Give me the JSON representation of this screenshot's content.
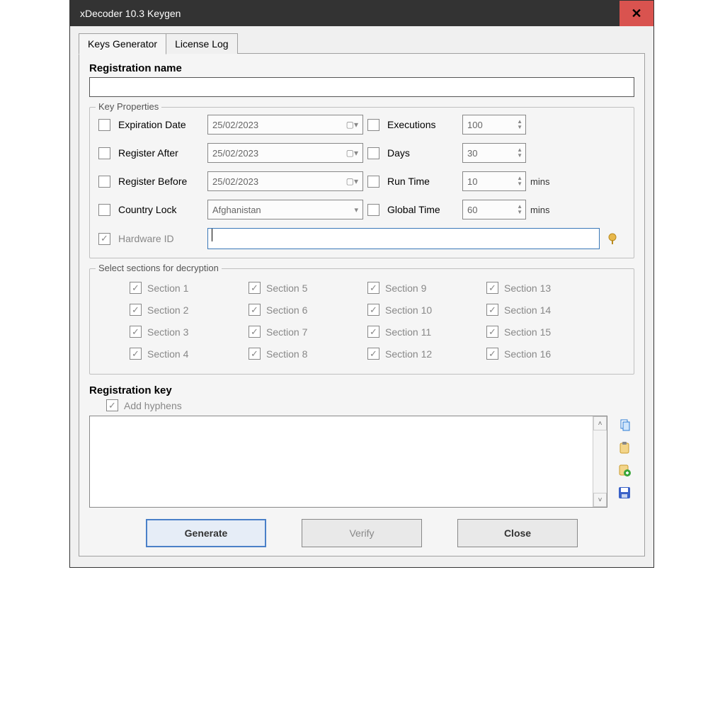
{
  "window": {
    "title": "xDecoder 10.3 Keygen"
  },
  "tabs": {
    "keys_generator": "Keys Generator",
    "license_log": "License Log"
  },
  "reg_name_label": "Registration name",
  "reg_name_value": "",
  "key_props": {
    "legend": "Key Properties",
    "expiration_date": {
      "label": "Expiration Date",
      "value": "25/02/2023"
    },
    "register_after": {
      "label": "Register After",
      "value": "25/02/2023"
    },
    "register_before": {
      "label": "Register Before",
      "value": "25/02/2023"
    },
    "country_lock": {
      "label": "Country Lock",
      "value": "Afghanistan"
    },
    "executions": {
      "label": "Executions",
      "value": "100"
    },
    "days": {
      "label": "Days",
      "value": "30"
    },
    "run_time": {
      "label": "Run Time",
      "value": "10",
      "units": "mins"
    },
    "global_time": {
      "label": "Global Time",
      "value": "60",
      "units": "mins"
    },
    "hardware_id": {
      "label": "Hardware ID",
      "value": ""
    }
  },
  "sections": {
    "legend": "Select sections for decryption",
    "items": {
      "s1": "Section 1",
      "s2": "Section 2",
      "s3": "Section 3",
      "s4": "Section 4",
      "s5": "Section 5",
      "s6": "Section 6",
      "s7": "Section 7",
      "s8": "Section 8",
      "s9": "Section 9",
      "s10": "Section 10",
      "s11": "Section 11",
      "s12": "Section 12",
      "s13": "Section 13",
      "s14": "Section 14",
      "s15": "Section 15",
      "s16": "Section 16"
    }
  },
  "reg_key": {
    "label": "Registration key",
    "add_hyphens": "Add hyphens",
    "value": ""
  },
  "buttons": {
    "generate": "Generate",
    "verify": "Verify",
    "close": "Close"
  }
}
